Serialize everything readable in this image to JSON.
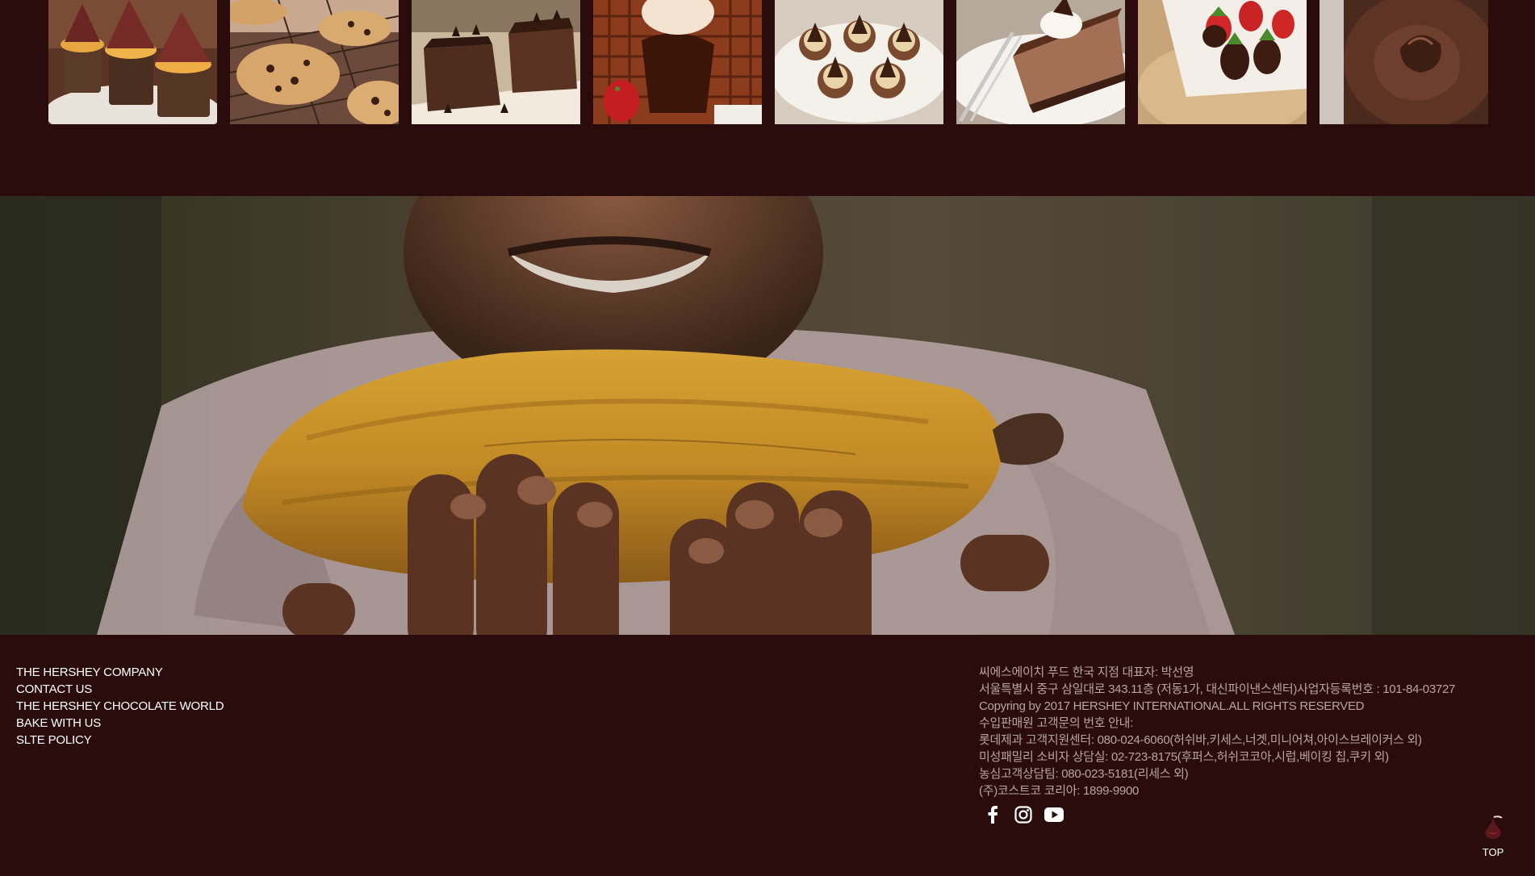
{
  "gallery": {
    "items": [
      {
        "icon": "chocolate-cupcakes-image"
      },
      {
        "icon": "chocolate-chip-cookies-image"
      },
      {
        "icon": "chocolate-brownies-image"
      },
      {
        "icon": "chocolate-waffles-image"
      },
      {
        "icon": "kisses-cupcakes-image"
      },
      {
        "icon": "chocolate-cheesecake-image"
      },
      {
        "icon": "chocolate-strawberries-image"
      },
      {
        "icon": "chocolate-frosting-image"
      }
    ]
  },
  "hero": {
    "icon": "cacao-pod-photo"
  },
  "footer": {
    "links": [
      "THE HERSHEY COMPANY",
      "CONTACT US",
      "THE HERSHEY CHOCOLATE WORLD",
      "BAKE WITH US",
      "SLTE POLICY"
    ],
    "info": [
      "씨에스에이치 푸드 한국 지점 대표자: 박선영",
      "서울특별시 중구 삼일대로 343.11층 (저동1가, 대신파이낸스센터)사업자등록번호 : 101-84-03727",
      "Copyring by 2017 HERSHEY INTERNATIONAL.ALL RIGHTS RESERVED",
      "수입판매원 고객문의 번호 안내:",
      "롯데제과 고객지원센터: 080-024-6060(허쉬바,키세스,너겟,미니어쳐,아이스브레이커스 외)",
      "미성패밀리 소비자 상담실: 02-723-8175(후퍼스,허쉬코코아,시럽,베이킹 칩,쿠키 외)",
      "농심고객상담팀: 080-023-5181(리세스 외)",
      "(주)코스트코 코리아: 1899-9900"
    ],
    "social": [
      "facebook-icon",
      "instagram-icon",
      "youtube-icon"
    ],
    "top_label": "TOP"
  },
  "colors": {
    "background": "#2a0c0c",
    "info_text": "#b7a5a2",
    "link_text": "#ffffff"
  }
}
